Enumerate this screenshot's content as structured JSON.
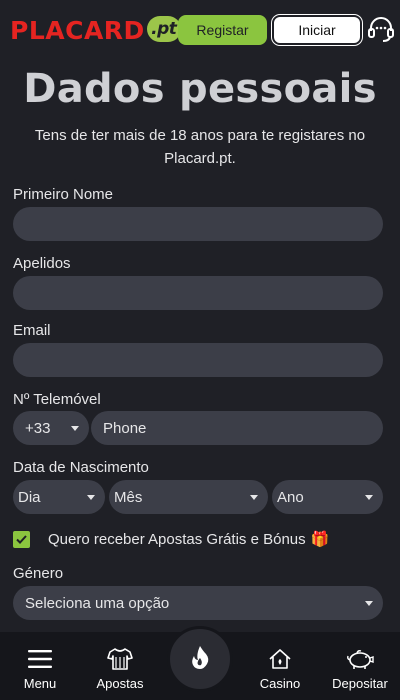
{
  "header": {
    "logo_text": "PLACARD",
    "logo_suffix": ".pt",
    "register_label": "Registar",
    "login_label": "Iniciar",
    "support_icon": "headset-icon"
  },
  "form": {
    "title": "Dados pessoais",
    "subtitle": "Tens de ter mais de 18 anos para te registares no Placard.pt.",
    "first_name": {
      "label": "Primeiro Nome",
      "value": ""
    },
    "last_name": {
      "label": "Apelidos",
      "value": ""
    },
    "email": {
      "label": "Email",
      "value": ""
    },
    "phone": {
      "label": "Nº Telemóvel",
      "country_code": "+33",
      "placeholder": "Phone"
    },
    "birth_date": {
      "label": "Data de Nascimento",
      "day": "Dia",
      "month": "Mês",
      "year": "Ano"
    },
    "promo": {
      "label": "Quero receber Apostas Grátis e Bónus",
      "checked": true,
      "emoji": "🎁"
    },
    "gender": {
      "label": "Género",
      "selected": "Seleciona uma opção"
    }
  },
  "bottom_nav": {
    "items": [
      {
        "label": "Menu",
        "icon": "hamburger-icon"
      },
      {
        "label": "Apostas",
        "icon": "jersey-icon"
      },
      {
        "label": "",
        "icon": "flame-icon"
      },
      {
        "label": "Casino",
        "icon": "house-icon"
      },
      {
        "label": "Depositar",
        "icon": "piggy-bank-icon"
      }
    ]
  },
  "colors": {
    "background": "#1f2026",
    "field": "#3c3e48",
    "accent_green": "#8bc53f",
    "logo_red": "#e52421",
    "nav_bg": "#15161b"
  }
}
